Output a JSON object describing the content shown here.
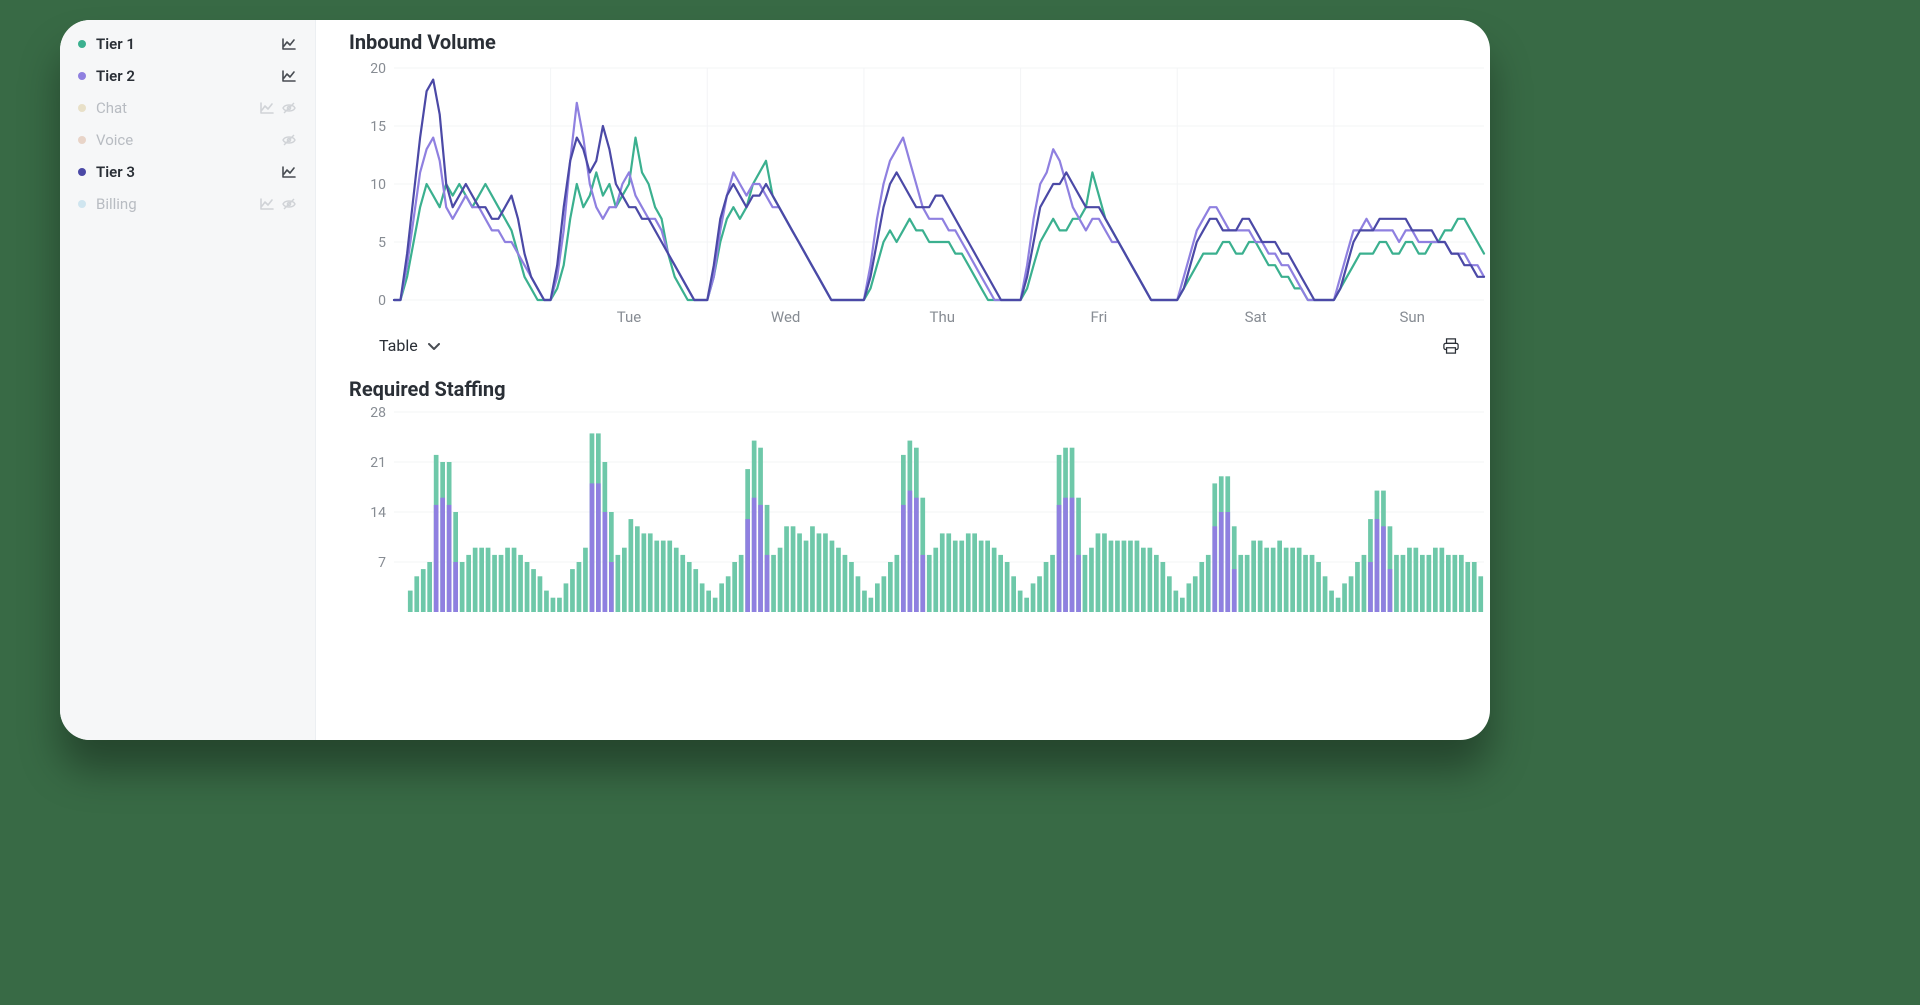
{
  "sidebar": {
    "items": [
      {
        "label": "Tier 1",
        "color": "#3bb08f",
        "active": true,
        "hasChart": true,
        "hidden": false
      },
      {
        "label": "Tier 2",
        "color": "#8f80e0",
        "active": true,
        "hasChart": true,
        "hidden": false
      },
      {
        "label": "Chat",
        "color": "#e8e0c8",
        "active": false,
        "hasChart": true,
        "hidden": true
      },
      {
        "label": "Voice",
        "color": "#e8d4c8",
        "active": false,
        "hasChart": false,
        "hidden": true
      },
      {
        "label": "Tier 3",
        "color": "#4b49a6",
        "active": true,
        "hasChart": true,
        "hidden": false
      },
      {
        "label": "Billing",
        "color": "#cfe5ef",
        "active": false,
        "hasChart": true,
        "hidden": true
      }
    ]
  },
  "table_toggle": {
    "label": "Table"
  },
  "chart_data": [
    {
      "id": "inbound-volume",
      "type": "line",
      "title": "Inbound Volume",
      "xlabel": "",
      "ylabel": "",
      "ylim": [
        0,
        20
      ],
      "yticks": [
        0,
        5,
        10,
        15,
        20
      ],
      "xticks": [
        "Tue",
        "Wed",
        "Thu",
        "Fri",
        "Sat",
        "Sun"
      ],
      "n_points": 168,
      "series": [
        {
          "name": "Tier 1",
          "color": "#3bb08f",
          "values": [
            0,
            0,
            2,
            5,
            8,
            10,
            9,
            8,
            10,
            9,
            10,
            9,
            8,
            9,
            10,
            9,
            8,
            7,
            6,
            4,
            2,
            1,
            0,
            0,
            0,
            1,
            3,
            7,
            10,
            8,
            9,
            11,
            9,
            10,
            8,
            9,
            10,
            14,
            11,
            10,
            8,
            7,
            4,
            2,
            1,
            0,
            0,
            0,
            0,
            2,
            5,
            7,
            8,
            7,
            8,
            10,
            11,
            12,
            9,
            8,
            7,
            6,
            5,
            4,
            3,
            2,
            1,
            0,
            0,
            0,
            0,
            0,
            0,
            1,
            3,
            5,
            6,
            5,
            6,
            7,
            6,
            6,
            5,
            5,
            5,
            5,
            4,
            4,
            3,
            2,
            1,
            0,
            0,
            0,
            0,
            0,
            0,
            1,
            3,
            5,
            6,
            7,
            6,
            6,
            7,
            7,
            8,
            11,
            9,
            7,
            6,
            5,
            4,
            3,
            2,
            1,
            0,
            0,
            0,
            0,
            0,
            1,
            2,
            3,
            4,
            4,
            4,
            5,
            5,
            4,
            4,
            5,
            5,
            4,
            3,
            3,
            2,
            2,
            1,
            1,
            0,
            0,
            0,
            0,
            0,
            1,
            2,
            3,
            4,
            4,
            4,
            5,
            5,
            4,
            4,
            5,
            5,
            4,
            4,
            5,
            5,
            6,
            6,
            7,
            7,
            6,
            5,
            4
          ]
        },
        {
          "name": "Tier 2",
          "color": "#8f80e0",
          "values": [
            0,
            0,
            3,
            7,
            11,
            13,
            14,
            12,
            8,
            7,
            8,
            9,
            8,
            8,
            7,
            6,
            6,
            5,
            5,
            4,
            3,
            2,
            1,
            0,
            0,
            2,
            6,
            12,
            17,
            14,
            10,
            8,
            7,
            8,
            8,
            10,
            11,
            9,
            8,
            7,
            7,
            6,
            4,
            3,
            2,
            1,
            0,
            0,
            0,
            2,
            6,
            9,
            11,
            10,
            9,
            10,
            10,
            9,
            8,
            8,
            7,
            6,
            5,
            4,
            3,
            2,
            1,
            0,
            0,
            0,
            0,
            0,
            0,
            3,
            7,
            10,
            12,
            13,
            14,
            12,
            10,
            8,
            7,
            7,
            7,
            6,
            6,
            5,
            4,
            3,
            2,
            1,
            0,
            0,
            0,
            0,
            0,
            3,
            7,
            10,
            11,
            13,
            12,
            10,
            8,
            7,
            6,
            7,
            7,
            6,
            5,
            5,
            4,
            3,
            2,
            1,
            0,
            0,
            0,
            0,
            0,
            2,
            4,
            6,
            7,
            8,
            8,
            7,
            6,
            6,
            6,
            6,
            5,
            5,
            4,
            4,
            3,
            3,
            2,
            1,
            0,
            0,
            0,
            0,
            0,
            2,
            4,
            6,
            6,
            7,
            6,
            6,
            6,
            6,
            5,
            6,
            6,
            5,
            5,
            5,
            5,
            5,
            4,
            4,
            4,
            3,
            3,
            2
          ]
        },
        {
          "name": "Tier 3",
          "color": "#4b49a6",
          "values": [
            0,
            0,
            4,
            9,
            14,
            18,
            19,
            16,
            10,
            8,
            9,
            10,
            9,
            8,
            8,
            7,
            7,
            8,
            9,
            7,
            4,
            2,
            1,
            0,
            0,
            3,
            8,
            12,
            14,
            13,
            11,
            12,
            15,
            13,
            10,
            9,
            8,
            8,
            7,
            7,
            6,
            5,
            4,
            3,
            2,
            1,
            0,
            0,
            0,
            3,
            7,
            9,
            10,
            9,
            8,
            9,
            9,
            10,
            9,
            8,
            7,
            6,
            5,
            4,
            3,
            2,
            1,
            0,
            0,
            0,
            0,
            0,
            0,
            2,
            5,
            8,
            10,
            11,
            10,
            9,
            8,
            8,
            8,
            9,
            9,
            8,
            7,
            6,
            5,
            4,
            3,
            2,
            1,
            0,
            0,
            0,
            0,
            2,
            5,
            8,
            9,
            10,
            10,
            11,
            10,
            9,
            8,
            8,
            8,
            7,
            6,
            5,
            4,
            3,
            2,
            1,
            0,
            0,
            0,
            0,
            0,
            1,
            3,
            5,
            6,
            7,
            7,
            6,
            6,
            6,
            7,
            7,
            6,
            5,
            5,
            5,
            4,
            4,
            3,
            2,
            1,
            0,
            0,
            0,
            0,
            1,
            3,
            5,
            6,
            6,
            6,
            7,
            7,
            7,
            7,
            7,
            6,
            6,
            6,
            6,
            5,
            5,
            4,
            4,
            3,
            3,
            2,
            2
          ]
        }
      ]
    },
    {
      "id": "required-staffing",
      "type": "bar",
      "title": "Required Staffing",
      "xlabel": "",
      "ylabel": "",
      "ylim": [
        0,
        28
      ],
      "yticks": [
        7,
        14,
        21,
        28
      ],
      "n_points": 168,
      "total": [
        0,
        0,
        3,
        5,
        6,
        7,
        22,
        21,
        21,
        14,
        7,
        8,
        9,
        9,
        9,
        8,
        8,
        9,
        9,
        8,
        7,
        6,
        5,
        3,
        2,
        2,
        4,
        6,
        7,
        9,
        25,
        25,
        21,
        14,
        8,
        9,
        13,
        12,
        11,
        11,
        10,
        10,
        10,
        9,
        8,
        7,
        6,
        4,
        3,
        2,
        4,
        5,
        7,
        8,
        20,
        24,
        23,
        15,
        8,
        9,
        12,
        12,
        11,
        10,
        12,
        11,
        11,
        10,
        9,
        8,
        7,
        5,
        3,
        2,
        4,
        5,
        7,
        8,
        22,
        24,
        23,
        16,
        8,
        9,
        11,
        11,
        10,
        10,
        11,
        11,
        10,
        10,
        9,
        8,
        7,
        5,
        3,
        2,
        4,
        5,
        7,
        8,
        22,
        23,
        23,
        16,
        8,
        9,
        11,
        11,
        10,
        10,
        10,
        10,
        10,
        9,
        9,
        8,
        7,
        5,
        3,
        2,
        4,
        5,
        7,
        8,
        18,
        19,
        19,
        12,
        8,
        8,
        10,
        10,
        9,
        9,
        10,
        9,
        9,
        9,
        8,
        8,
        7,
        5,
        3,
        2,
        4,
        5,
        7,
        8,
        13,
        17,
        17,
        12,
        8,
        8,
        9,
        9,
        8,
        8,
        9,
        9,
        8,
        8,
        8,
        7,
        7,
        5
      ],
      "overlay": {
        "name": "Tier 2",
        "color": "#8f80e0",
        "values": [
          0,
          0,
          0,
          0,
          0,
          0,
          15,
          16,
          15,
          7,
          0,
          0,
          0,
          0,
          0,
          0,
          0,
          0,
          0,
          0,
          0,
          0,
          0,
          0,
          0,
          0,
          0,
          0,
          0,
          0,
          18,
          18,
          14,
          7,
          0,
          0,
          0,
          0,
          0,
          0,
          0,
          0,
          0,
          0,
          0,
          0,
          0,
          0,
          0,
          0,
          0,
          0,
          0,
          0,
          13,
          16,
          15,
          8,
          0,
          0,
          0,
          0,
          0,
          0,
          0,
          0,
          0,
          0,
          0,
          0,
          0,
          0,
          0,
          0,
          0,
          0,
          0,
          0,
          15,
          17,
          16,
          8,
          0,
          0,
          0,
          0,
          0,
          0,
          0,
          0,
          0,
          0,
          0,
          0,
          0,
          0,
          0,
          0,
          0,
          0,
          0,
          0,
          15,
          16,
          16,
          8,
          0,
          0,
          0,
          0,
          0,
          0,
          0,
          0,
          0,
          0,
          0,
          0,
          0,
          0,
          0,
          0,
          0,
          0,
          0,
          0,
          12,
          14,
          14,
          6,
          0,
          0,
          0,
          0,
          0,
          0,
          0,
          0,
          0,
          0,
          0,
          0,
          0,
          0,
          0,
          0,
          0,
          0,
          0,
          0,
          7,
          13,
          12,
          6,
          0,
          0,
          0,
          0,
          0,
          0,
          0,
          0,
          0,
          0,
          0,
          0,
          0,
          0
        ]
      }
    }
  ]
}
